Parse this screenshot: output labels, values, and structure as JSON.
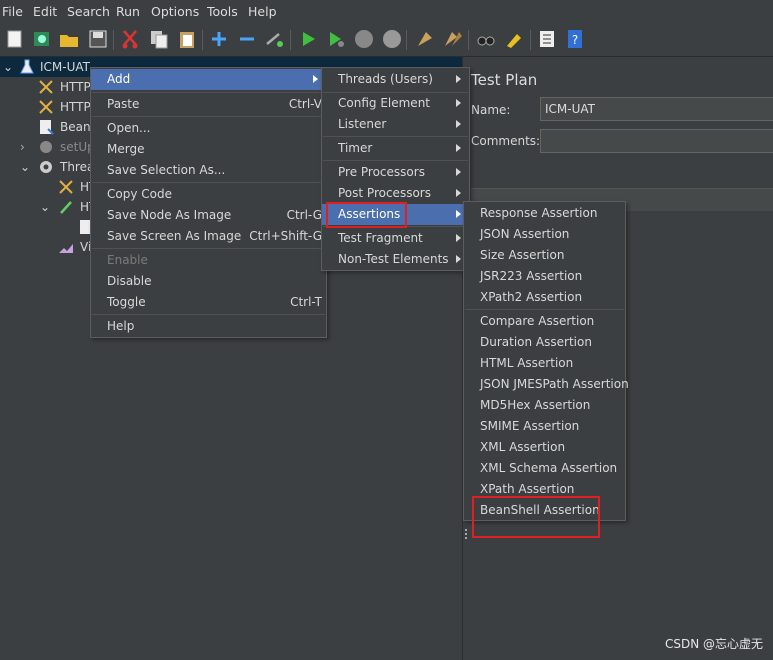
{
  "menubar": [
    "File",
    "Edit",
    "Search",
    "Run",
    "Options",
    "Tools",
    "Help"
  ],
  "tree": {
    "root": "ICM-UAT",
    "items": [
      "HTTP",
      "HTTP",
      "BeanS",
      "setUp",
      "Threa",
      "HT",
      "HT",
      "Vi"
    ]
  },
  "right_panel": {
    "title": "Test Plan",
    "name_label": "Name:",
    "name_value": "ICM-UAT",
    "comments_label": "Comments:"
  },
  "context_menu": {
    "items": [
      {
        "label": "Add",
        "shortcut": "",
        "submenu": true
      },
      {
        "label": "Paste",
        "shortcut": "Ctrl-V"
      },
      {
        "label": "Open...",
        "shortcut": ""
      },
      {
        "label": "Merge",
        "shortcut": ""
      },
      {
        "label": "Save Selection As...",
        "shortcut": ""
      },
      {
        "label": "Copy Code",
        "shortcut": ""
      },
      {
        "label": "Save Node As Image",
        "shortcut": "Ctrl-G"
      },
      {
        "label": "Save Screen As Image",
        "shortcut": "Ctrl+Shift-G"
      },
      {
        "label": "Enable",
        "shortcut": "",
        "disabled": true
      },
      {
        "label": "Disable",
        "shortcut": ""
      },
      {
        "label": "Toggle",
        "shortcut": "Ctrl-T"
      },
      {
        "label": "Help",
        "shortcut": ""
      }
    ]
  },
  "add_menu": {
    "items": [
      "Threads (Users)",
      "Config Element",
      "Listener",
      "Timer",
      "Pre Processors",
      "Post Processors",
      "Assertions",
      "Test Fragment",
      "Non-Test Elements"
    ]
  },
  "assertions_menu": {
    "items": [
      "Response Assertion",
      "JSON Assertion",
      "Size Assertion",
      "JSR223 Assertion",
      "XPath2 Assertion",
      "Compare Assertion",
      "Duration Assertion",
      "HTML Assertion",
      "JSON JMESPath Assertion",
      "MD5Hex Assertion",
      "SMIME Assertion",
      "XML Assertion",
      "XML Schema Assertion",
      "XPath Assertion",
      "BeanShell Assertion"
    ]
  },
  "watermark": "CSDN @忘心虚无",
  "colors": {
    "highlight": "#4b6eaf",
    "annotation": "#e02020",
    "background": "#3c3f41"
  }
}
